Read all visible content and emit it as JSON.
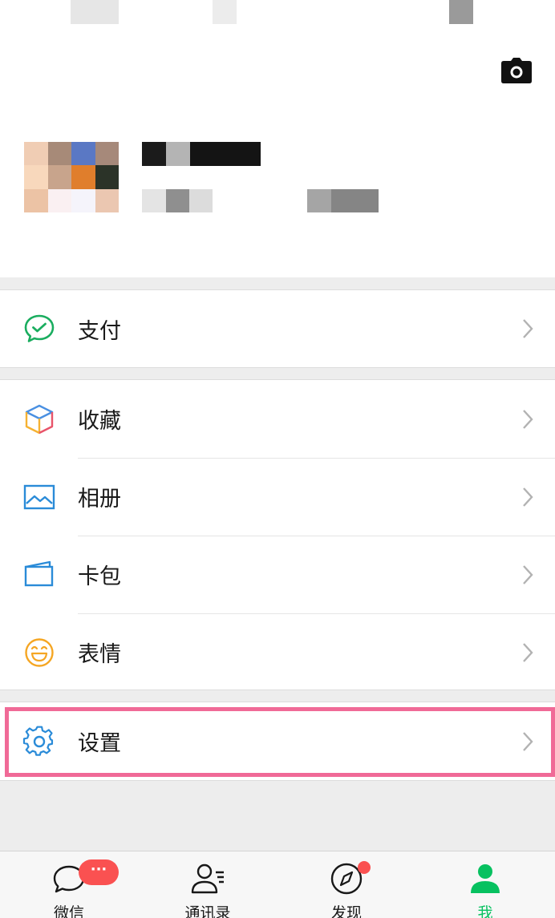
{
  "menu": {
    "pay": {
      "label": "支付",
      "icon": "wechat-pay-icon"
    },
    "favorites": {
      "label": "收藏",
      "icon": "favorites-cube-icon"
    },
    "album": {
      "label": "相册",
      "icon": "album-picture-icon"
    },
    "cards": {
      "label": "卡包",
      "icon": "card-wallet-icon"
    },
    "stickers": {
      "label": "表情",
      "icon": "sticker-smile-icon"
    },
    "settings": {
      "label": "设置",
      "icon": "gear-icon"
    }
  },
  "tabbar": {
    "chats": {
      "label": "微信",
      "badge": "···"
    },
    "contacts": {
      "label": "通讯录"
    },
    "discover": {
      "label": "发现"
    },
    "me": {
      "label": "我"
    }
  },
  "colors": {
    "accent_green": "#07c160",
    "badge_red": "#fa5151",
    "highlight_pink": "#f06a97",
    "background": "#ededed"
  }
}
